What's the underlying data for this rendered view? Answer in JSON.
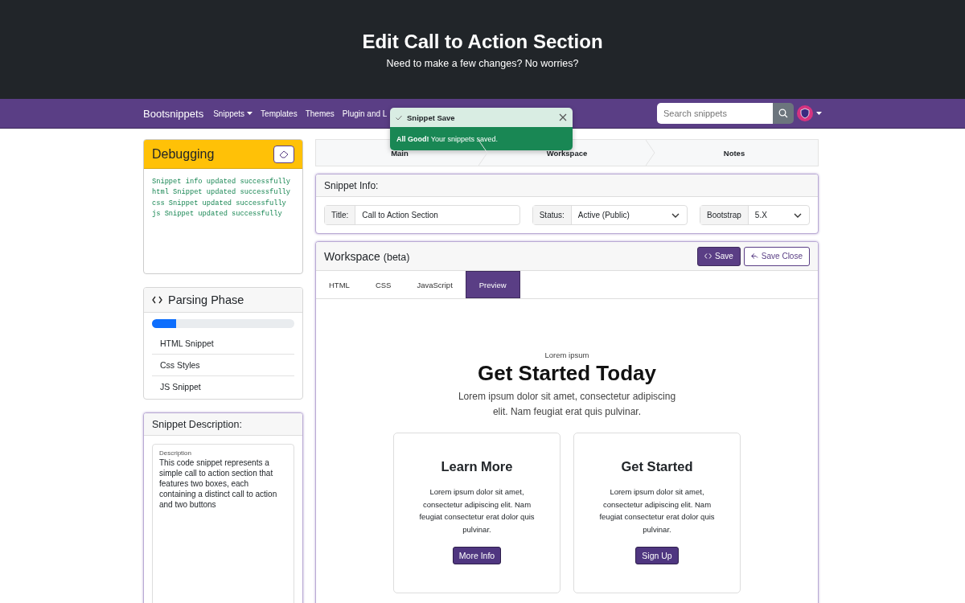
{
  "header": {
    "title": "Edit Call to Action Section",
    "subtitle": "Need to make a few changes? No worries?"
  },
  "navbar": {
    "brand": "Bootsnippets",
    "links": [
      {
        "label": "Snippets",
        "dropdown": true
      },
      {
        "label": "Templates",
        "dropdown": false
      },
      {
        "label": "Themes",
        "dropdown": false
      },
      {
        "label": "Plugin and L",
        "dropdown": false
      }
    ],
    "search": {
      "placeholder": "Search snippets"
    }
  },
  "toast": {
    "title": "Snippet Save",
    "message": "**All Good!** Your snippets saved."
  },
  "debugging": {
    "title": "Debugging",
    "log": [
      "Snippet info updated successfully",
      "html Snippet updated successfully",
      "css Snippet updated successfully",
      "js Snippet updated successfully"
    ]
  },
  "parsing": {
    "title": "Parsing Phase",
    "level": 0.17,
    "items": [
      "HTML Snippet",
      "Css Styles",
      "JS Snippet"
    ]
  },
  "description": {
    "title": "Snippet Description:",
    "label": "Description",
    "value": "This code snippet represents a simple call to action section that features two boxes, each containing a distinct call to action and two buttons"
  },
  "steps": [
    {
      "label": "Main"
    },
    {
      "label": "Workspace"
    },
    {
      "label": "Notes"
    }
  ],
  "snippet_info": {
    "title": "Snippet Info:",
    "fields": [
      {
        "kind": "text",
        "label": "Title:",
        "value": "Call to Action Section"
      },
      {
        "kind": "select",
        "label": "Status:",
        "value": "Active (Public)"
      },
      {
        "kind": "select",
        "label": "Bootstrap",
        "value": "5.X"
      }
    ]
  },
  "workspace": {
    "title": "Workspace",
    "badge": "(beta)",
    "buttons": [
      {
        "kind": "primary",
        "label": "Save"
      },
      {
        "kind": "outline",
        "label": "Save Close"
      }
    ],
    "tabs": [
      {
        "label": "HTML",
        "selected": false
      },
      {
        "label": "CSS",
        "selected": false
      },
      {
        "label": "JavaScript",
        "selected": false
      },
      {
        "label": "Preview",
        "selected": true
      }
    ],
    "preview": {
      "eyebrow": "Lorem ipsum",
      "heading": "Get Started Today",
      "lead": "Lorem ipsum dolor sit amet, consectetur adipiscing elit. Nam feugiat erat quis pulvinar.",
      "cards": [
        {
          "title": "Learn More",
          "text": "Lorem ipsum dolor sit amet, consectetur adipiscing elit. Nam feugiat consectetur erat dolor quis pulvinar.",
          "button": "More Info"
        },
        {
          "title": "Get Started",
          "text": "Lorem ipsum dolor sit amet, consectetur adipiscing elit. Nam feugiat consectetur erat dolor quis pulvinar.",
          "button": "Sign Up"
        }
      ]
    }
  }
}
